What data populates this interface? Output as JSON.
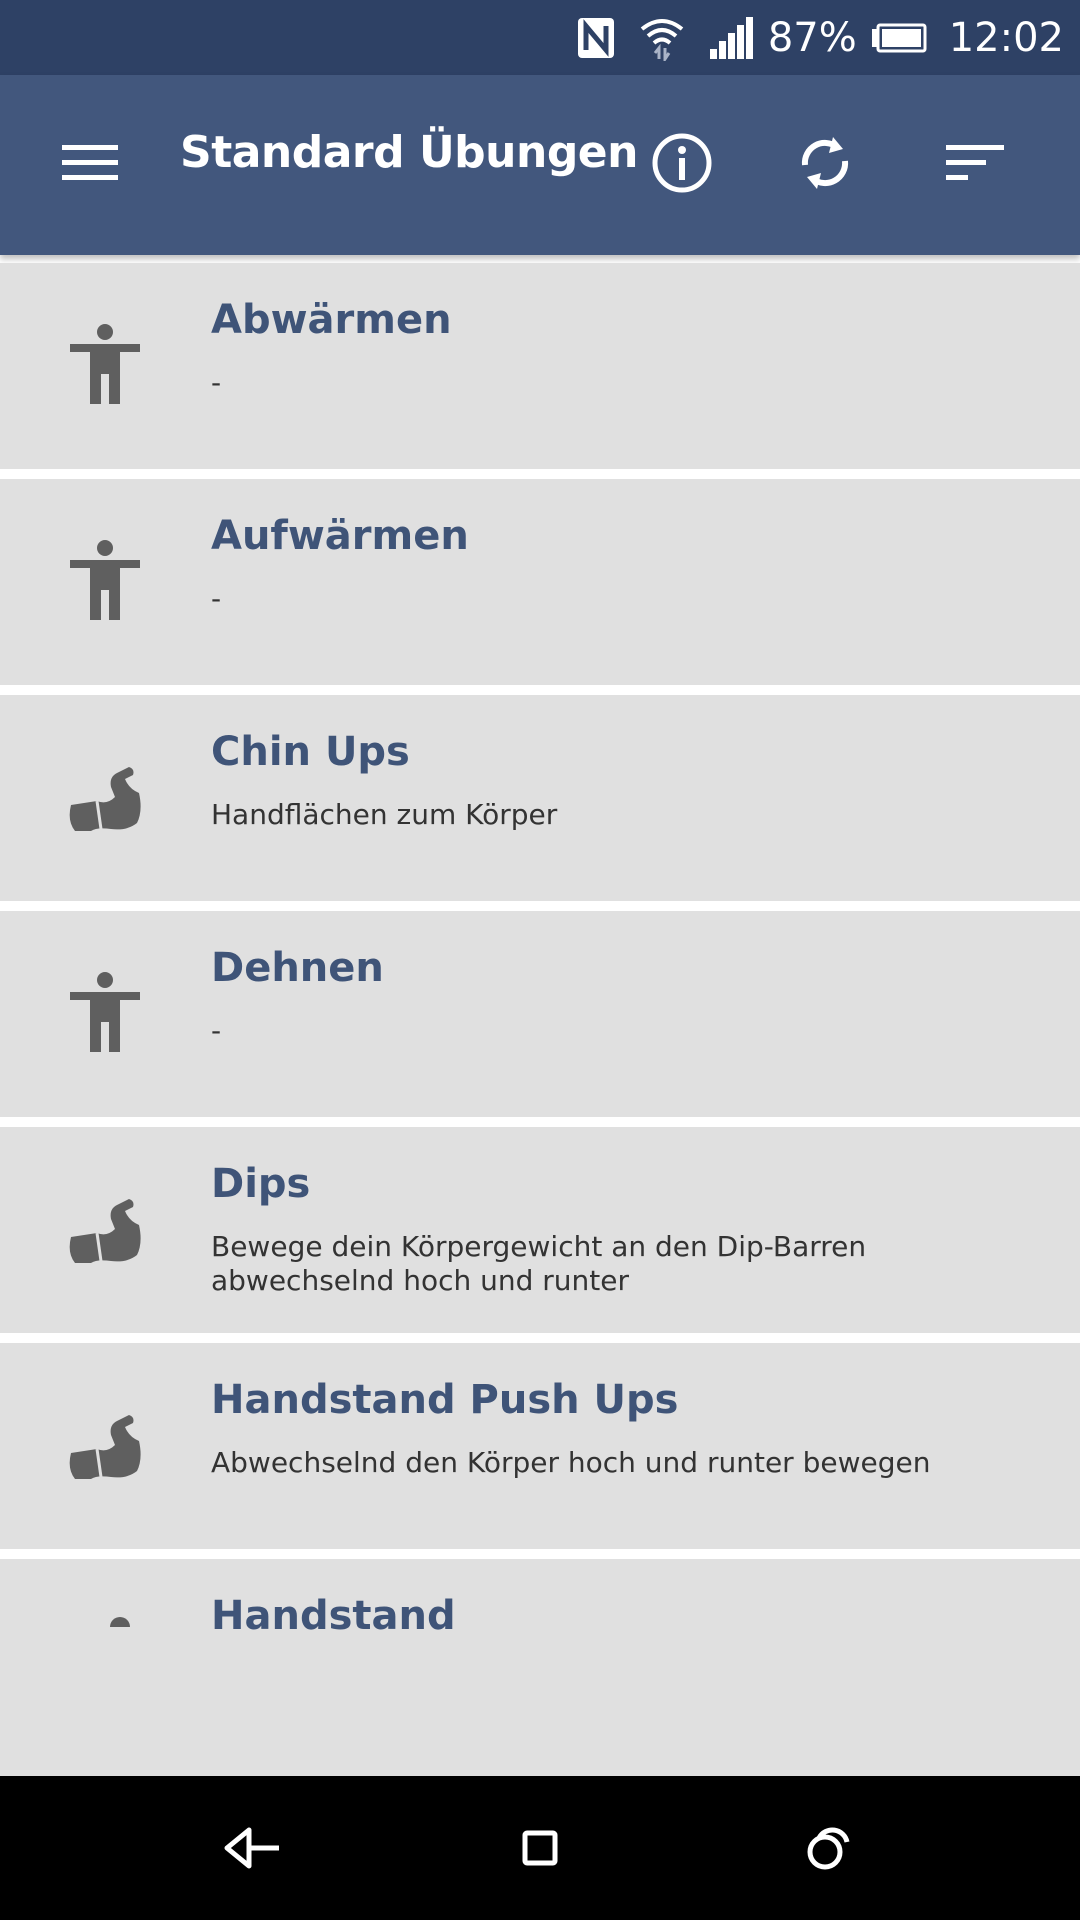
{
  "status_bar": {
    "battery_percent": "87%",
    "time": "12:02",
    "icons": [
      "nfc-icon",
      "wifi-icon",
      "signal-icon",
      "battery-icon"
    ]
  },
  "app_bar": {
    "title": "Standard Übungen",
    "icons": [
      "menu-icon",
      "info-icon",
      "sync-icon",
      "sort-icon"
    ]
  },
  "exercises": [
    {
      "name": "Abwärmen",
      "description": "-",
      "icon": "body-icon"
    },
    {
      "name": "Aufwärmen",
      "description": "-",
      "icon": "body-icon"
    },
    {
      "name": "Chin Ups",
      "description": "Handflächen zum Körper",
      "icon": "muscle-icon"
    },
    {
      "name": "Dehnen",
      "description": "-",
      "icon": "body-icon"
    },
    {
      "name": "Dips",
      "description": "Bewege dein Körpergewicht an den Dip-Barren abwechselnd hoch und runter",
      "icon": "muscle-icon"
    },
    {
      "name": "Handstand Push Ups",
      "description": "Abwechselnd den Körper hoch und runter bewegen",
      "icon": "muscle-icon"
    },
    {
      "name": "Handstand",
      "description": "",
      "icon": "body-icon"
    }
  ],
  "nav_bar": {
    "icons": [
      "back-icon",
      "home-icon",
      "recents-icon"
    ]
  },
  "colors": {
    "status_bar": "#2e4165",
    "app_bar": "#42577d",
    "list_item_bg": "#e0e0e0",
    "title_text": "#3f5478",
    "icon_gray": "#5f5f5f"
  }
}
